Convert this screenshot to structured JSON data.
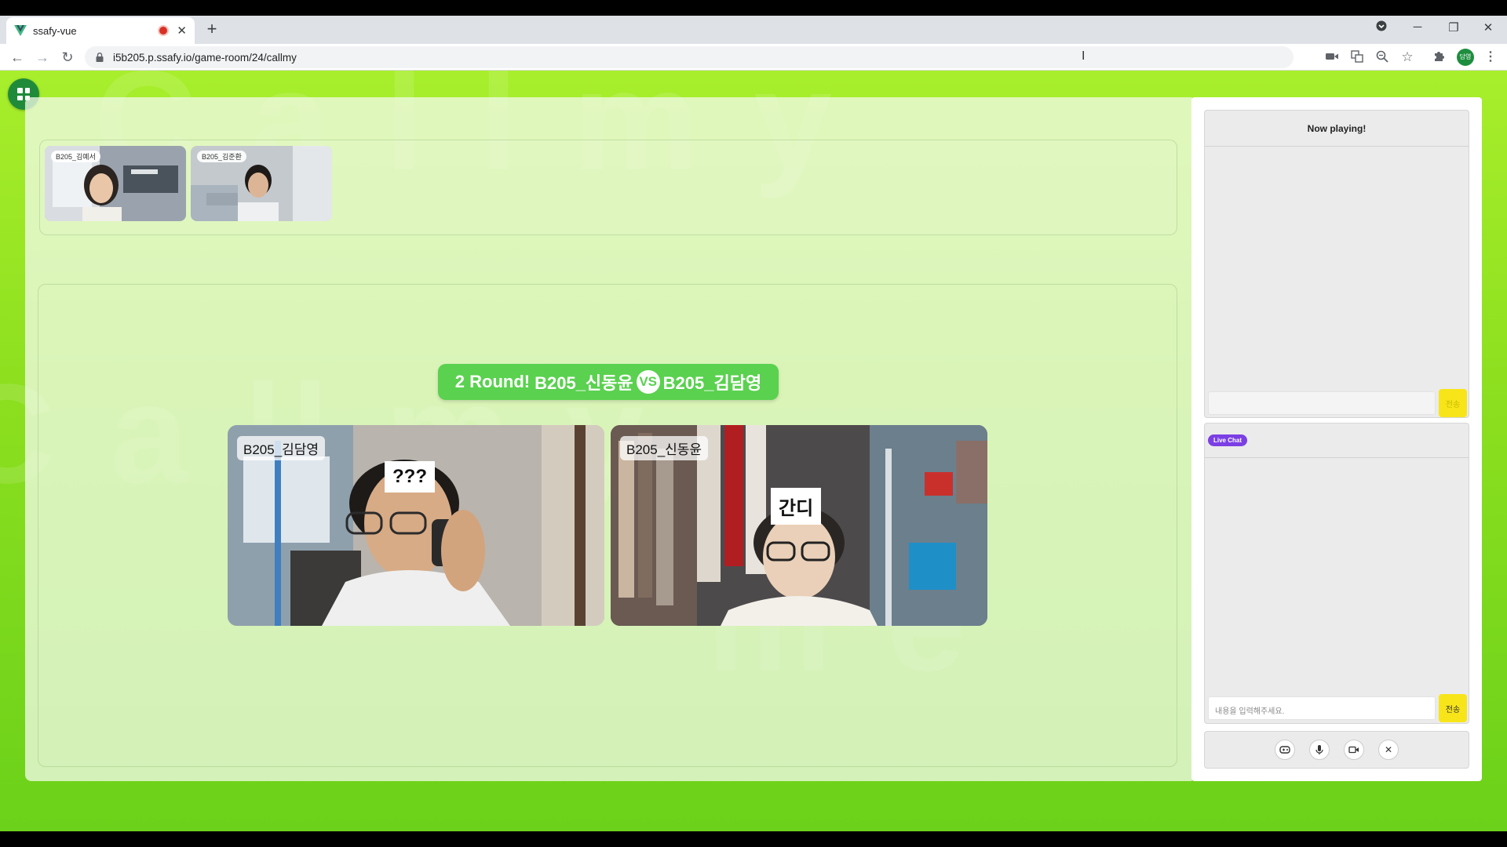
{
  "browser": {
    "tab_title": "ssafy-vue",
    "url": "i5b205.p.ssafy.io/game-room/24/callmy",
    "profile_initials": "담영"
  },
  "room": {
    "thumbnails": [
      {
        "name": "B205_김예서"
      },
      {
        "name": "B205_김준환"
      }
    ],
    "banner": {
      "round_text": "2 Round!",
      "player_left": "B205_신동윤",
      "vs": "VS",
      "player_right": "B205_김담영"
    },
    "videos": [
      {
        "name": "B205_김담영",
        "reaction": "???"
      },
      {
        "name": "B205_신동윤",
        "reaction": "간디"
      }
    ]
  },
  "sidebar": {
    "now_playing_title": "Now playing!",
    "now_playing_send": "전송",
    "live_chat_badge": "Live Chat",
    "chat_placeholder": "내용을 입력해주세요.",
    "chat_send": "전송"
  },
  "colors": {
    "page_bg": "#8ee01f",
    "banner": "#5ad14f",
    "send_button": "#f7e51a",
    "live_chat_badge": "#7b3fe4",
    "home_button": "#1f8b3a"
  }
}
